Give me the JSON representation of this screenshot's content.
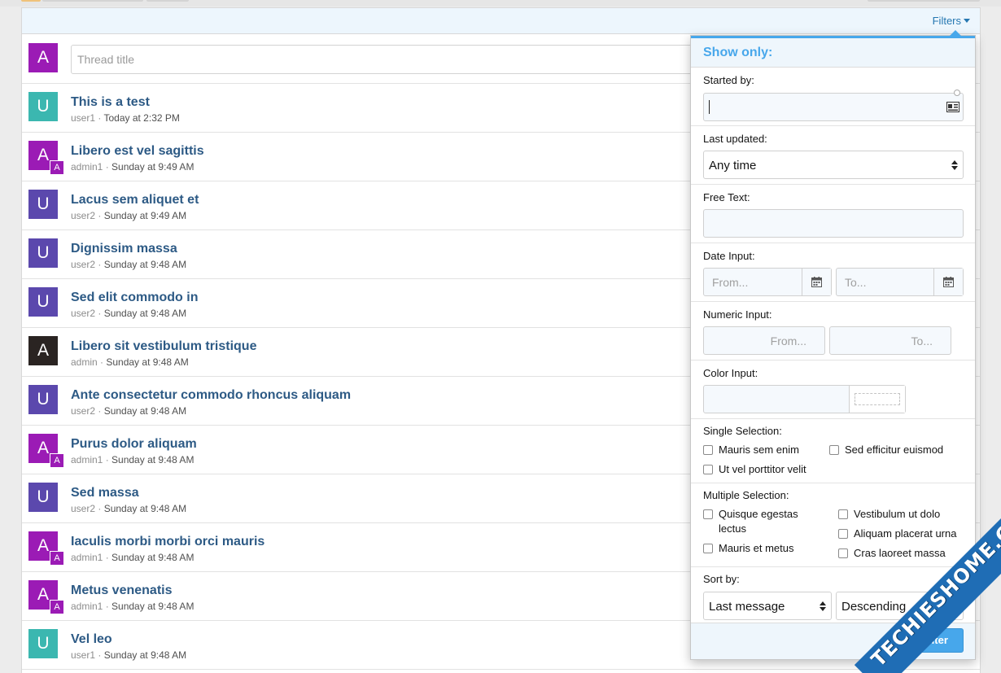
{
  "header": {
    "filters_label": "Filters"
  },
  "composer": {
    "avatar_letter": "A",
    "avatar_color": "#9b1bb5",
    "placeholder": "Thread title"
  },
  "threads": [
    {
      "title": "This is a test",
      "user": "user1",
      "when": "Today at 2:32 PM",
      "letter": "U",
      "color": "#3bb7b0",
      "badge": ""
    },
    {
      "title": "Libero est vel sagittis",
      "user": "admin1",
      "when": "Sunday at 9:49 AM",
      "letter": "A",
      "color": "#9b1bb5",
      "badge": "A"
    },
    {
      "title": "Lacus sem aliquet et",
      "user": "user2",
      "when": "Sunday at 9:49 AM",
      "letter": "U",
      "color": "#5b48ad",
      "badge": ""
    },
    {
      "title": "Dignissim massa",
      "user": "user2",
      "when": "Sunday at 9:48 AM",
      "letter": "U",
      "color": "#5b48ad",
      "badge": ""
    },
    {
      "title": "Sed elit commodo in",
      "user": "user2",
      "when": "Sunday at 9:48 AM",
      "letter": "U",
      "color": "#5b48ad",
      "badge": ""
    },
    {
      "title": "Libero sit vestibulum tristique",
      "user": "admin",
      "when": "Sunday at 9:48 AM",
      "letter": "A",
      "color": "#2a2422",
      "badge": ""
    },
    {
      "title": "Ante consectetur commodo rhoncus aliquam",
      "user": "user2",
      "when": "Sunday at 9:48 AM",
      "letter": "U",
      "color": "#5b48ad",
      "badge": ""
    },
    {
      "title": "Purus dolor aliquam",
      "user": "admin1",
      "when": "Sunday at 9:48 AM",
      "letter": "A",
      "color": "#9b1bb5",
      "badge": "A"
    },
    {
      "title": "Sed massa",
      "user": "user2",
      "when": "Sunday at 9:48 AM",
      "letter": "U",
      "color": "#5b48ad",
      "badge": ""
    },
    {
      "title": "Iaculis morbi morbi orci mauris",
      "user": "admin1",
      "when": "Sunday at 9:48 AM",
      "letter": "A",
      "color": "#9b1bb5",
      "badge": "A"
    },
    {
      "title": "Metus venenatis",
      "user": "admin1",
      "when": "Sunday at 9:48 AM",
      "letter": "A",
      "color": "#9b1bb5",
      "badge": "A"
    },
    {
      "title": "Vel leo",
      "user": "user1",
      "when": "Sunday at 9:48 AM",
      "letter": "U",
      "color": "#3bb7b0",
      "badge": ""
    }
  ],
  "filters": {
    "heading": "Show only:",
    "started_by": {
      "label": "Started by:",
      "value": ""
    },
    "last_updated": {
      "label": "Last updated:",
      "value": "Any time"
    },
    "free_text": {
      "label": "Free Text:",
      "value": ""
    },
    "date_input": {
      "label": "Date Input:",
      "from_placeholder": "From...",
      "to_placeholder": "To..."
    },
    "numeric_input": {
      "label": "Numeric Input:",
      "from_placeholder": "From...",
      "to_placeholder": "To..."
    },
    "color_input": {
      "label": "Color Input:",
      "value": ""
    },
    "single_selection": {
      "label": "Single Selection:",
      "options": [
        "Mauris sem enim",
        "Sed efficitur euismod",
        "Ut vel porttitor velit"
      ]
    },
    "multiple_selection": {
      "label": "Multiple Selection:",
      "options": [
        "Quisque egestas",
        "lectus",
        "Vestibulum ut dolo",
        "Aliquam placerat urna",
        "Mauris et metus",
        "Cras laoreet massa"
      ]
    },
    "sort_by": {
      "label": "Sort by:",
      "field": "Last message",
      "direction": "Descending"
    },
    "submit_label": "Filter"
  },
  "watermark": {
    "text": "TECHIESHOME.COM",
    "color": "#1f6db5",
    "accent": "#f2b21c"
  }
}
